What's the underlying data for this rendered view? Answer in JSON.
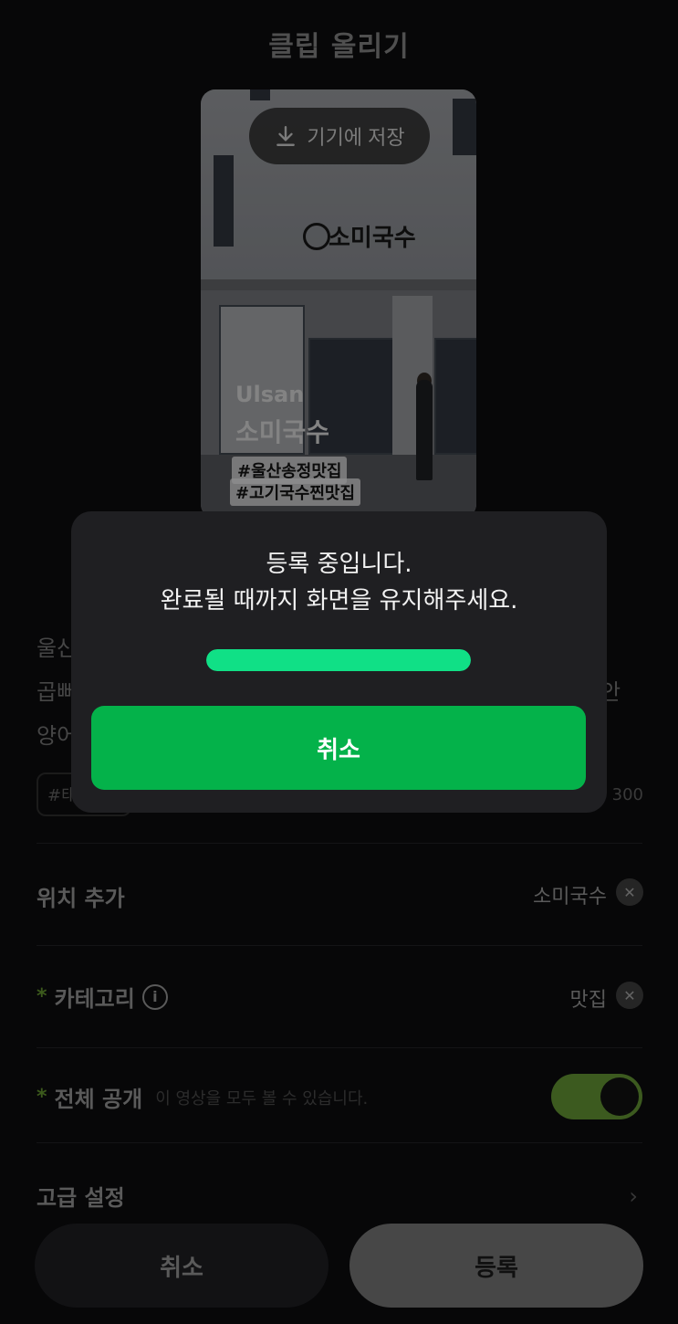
{
  "header": {
    "title": "클립 올리기"
  },
  "thumbnail": {
    "save_button_label": "기기에 저장",
    "sign_text": "소미국수",
    "overlay_en": "Ulsan",
    "overlay_ko": "소미국수",
    "tags": [
      "#울산송정맛집",
      "#고기국수찐맛집"
    ]
  },
  "description": {
    "line1": "울산",
    "line2": "곱뻐",
    "line2_right": "안",
    "line3": "양어"
  },
  "hashtag": {
    "placeholder": "#태",
    "counter": "300"
  },
  "location": {
    "label": "위치 추가",
    "value": "소미국수"
  },
  "category": {
    "required_mark": "*",
    "label": "카테고리",
    "info": "i",
    "value": "맛집"
  },
  "visibility": {
    "required_mark": "*",
    "label": "전체 공개",
    "sub": "이 영상을 모두 볼 수 있습니다.",
    "enabled": true
  },
  "advanced": {
    "label": "고급 설정"
  },
  "footer": {
    "cancel_label": "취소",
    "register_label": "등록"
  },
  "modal": {
    "message_line1": "등록 중입니다.",
    "message_line2": "완료될 때까지 화면을 유지해주세요.",
    "progress_percent": 100,
    "cancel_label": "취소",
    "progress_color": "#10e086",
    "button_color": "#04b24a"
  }
}
